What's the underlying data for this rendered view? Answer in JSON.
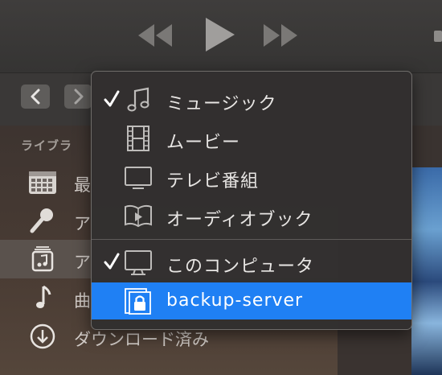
{
  "toolbar": {
    "buttons": [
      "rewind-icon",
      "play-icon",
      "fast-forward-icon"
    ]
  },
  "sidebar": {
    "heading": "ライブラ",
    "items": [
      {
        "label": "最",
        "icon": "calendar-grid-icon"
      },
      {
        "label": "ア",
        "icon": "microphone-icon"
      },
      {
        "label": "ア",
        "icon": "album-icon",
        "selected": true
      },
      {
        "label": "曲",
        "icon": "music-note-icon"
      },
      {
        "label": "ダウンロード済み",
        "icon": "download-icon"
      }
    ]
  },
  "menu": {
    "items": [
      {
        "label": "ミュージック",
        "icon": "music-notes-icon",
        "checked": true
      },
      {
        "label": "ムービー",
        "icon": "film-icon",
        "checked": false
      },
      {
        "label": "テレビ番組",
        "icon": "tv-icon",
        "checked": false
      },
      {
        "label": "オーディオブック",
        "icon": "audiobook-icon",
        "checked": false
      },
      {
        "label": "このコンピュータ",
        "icon": "computer-icon",
        "checked": true
      },
      {
        "label": "backup-server",
        "icon": "locked-library-icon",
        "checked": false,
        "highlighted": true
      }
    ]
  },
  "colors": {
    "highlight": "#1f80f4",
    "menu_bg": "#32302f"
  }
}
